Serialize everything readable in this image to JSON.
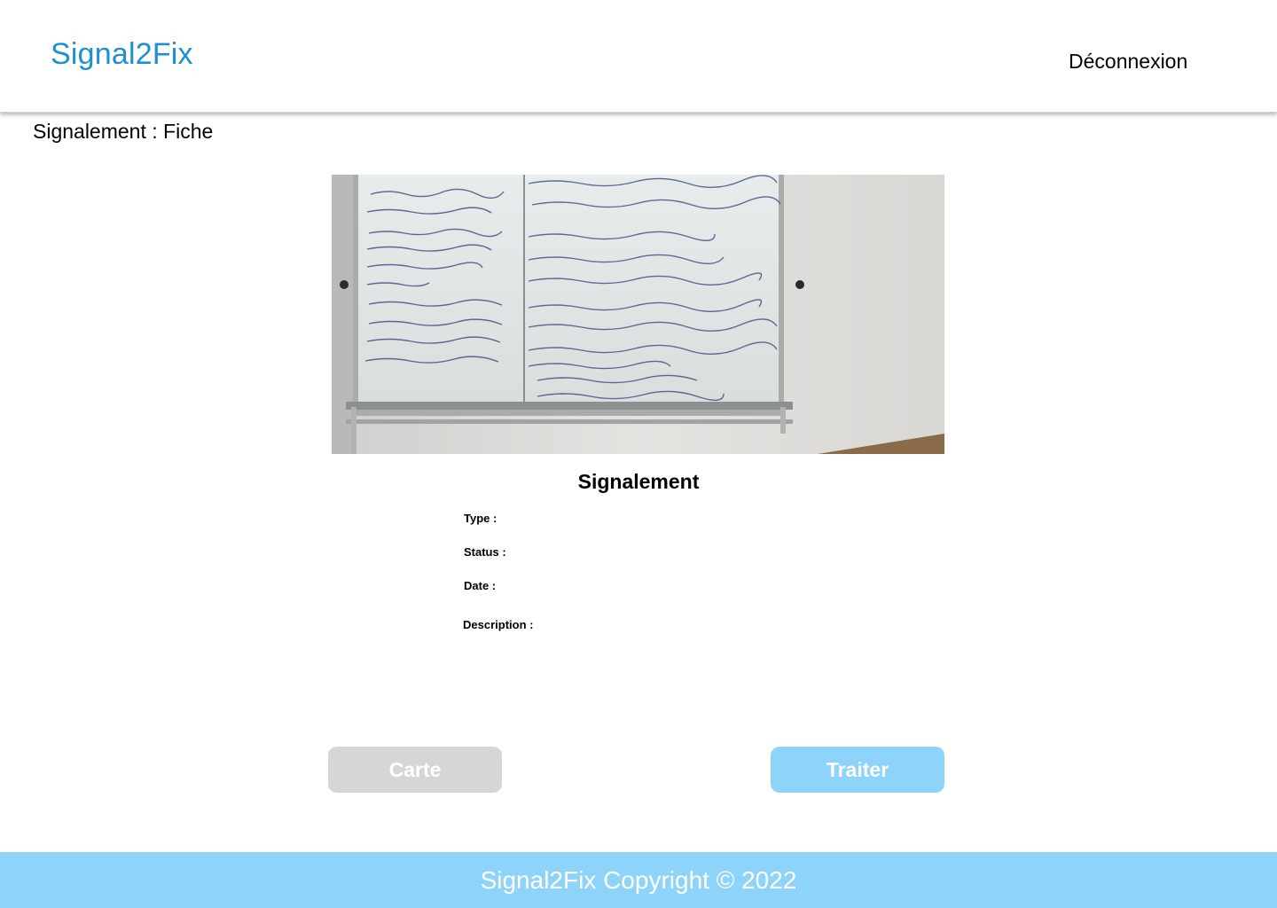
{
  "header": {
    "brand": "Signal2Fix",
    "logout_label": "Déconnexion"
  },
  "page": {
    "title": "Signalement : Fiche"
  },
  "report": {
    "image_alt": "whiteboard-photo",
    "heading": "Signalement",
    "type_label": "Type :",
    "status_label": "Status :",
    "date_label": "Date :",
    "description_label": "Description :"
  },
  "actions": {
    "map_label": "Carte",
    "treat_label": "Traiter"
  },
  "footer": {
    "copyright": "Signal2Fix Copyright ©  2022"
  },
  "colors": {
    "brand": "#1e8fd0",
    "footer_bg": "#8dd3fa",
    "treat_button": "#8dd3fa",
    "map_button": "#d6d6d6"
  }
}
